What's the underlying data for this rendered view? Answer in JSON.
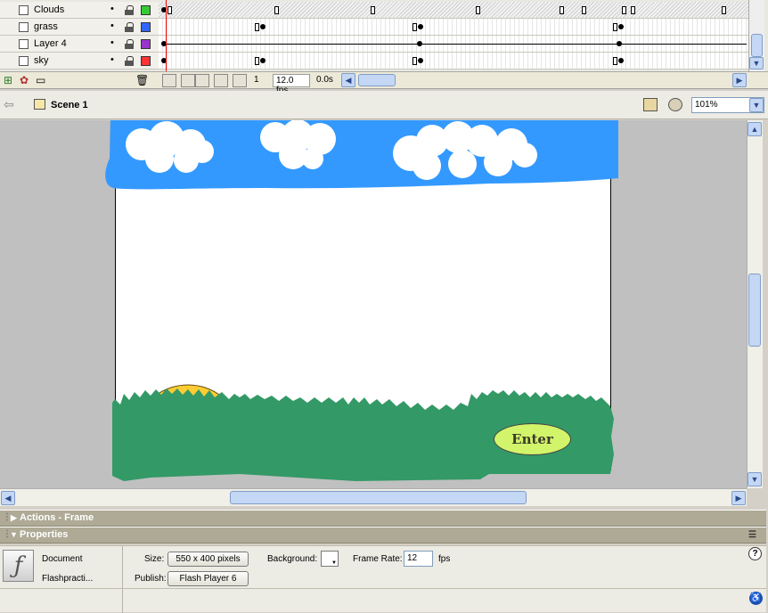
{
  "timeline": {
    "layers": [
      {
        "name": "Clouds",
        "color": "#33cc33"
      },
      {
        "name": "grass",
        "color": "#3366ff"
      },
      {
        "name": "Layer 4",
        "color": "#9933cc"
      },
      {
        "name": "sky",
        "color": "#ff3333"
      }
    ],
    "visibility_dot": "•",
    "current_frame": "1",
    "frame_rate": "12.0 fps",
    "elapsed_time": "0.0s"
  },
  "scenebar": {
    "scene_name": "Scene 1",
    "zoom": "101%"
  },
  "stage": {
    "enter_button_label": "Enter"
  },
  "panels": {
    "actions_title": "Actions - Frame",
    "properties_title": "Properties"
  },
  "properties": {
    "doc_type": "Document",
    "doc_name": "Flashpracti...",
    "size_label": "Size:",
    "size_value": "550 x 400 pixels",
    "background_label": "Background:",
    "frame_rate_label": "Frame Rate:",
    "frame_rate_value": "12",
    "fps_unit": "fps",
    "publish_label": "Publish:",
    "publish_value": "Flash Player 6",
    "help_glyph": "?"
  },
  "colors": {
    "sky": "#3399ff",
    "cloud": "#ffffff",
    "grass": "#339966",
    "sun": "#ffcc33",
    "enter_fill": "#d2f46a"
  }
}
